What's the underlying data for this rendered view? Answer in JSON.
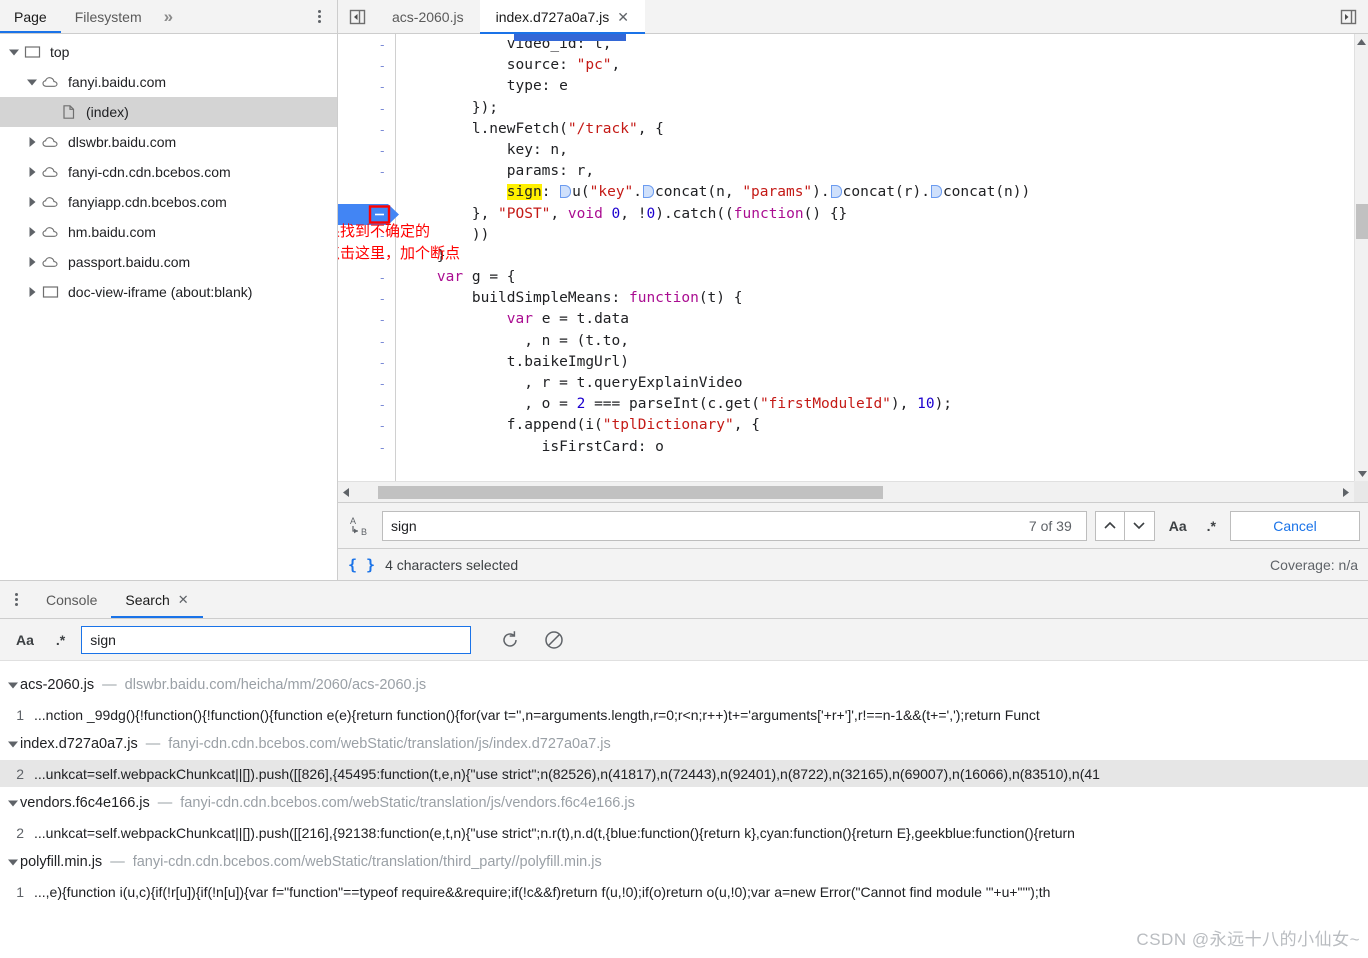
{
  "navigator": {
    "tabs": [
      {
        "label": "Page",
        "active": true
      },
      {
        "label": "Filesystem",
        "active": false
      }
    ],
    "more_label": "»",
    "tree": [
      {
        "indent": 0,
        "twisty": "down",
        "icon": "frame-icon",
        "label": "top",
        "selected": false
      },
      {
        "indent": 1,
        "twisty": "down",
        "icon": "cloud-icon",
        "label": "fanyi.baidu.com",
        "selected": false
      },
      {
        "indent": 2,
        "twisty": "none",
        "icon": "document-icon",
        "label": "(index)",
        "selected": true
      },
      {
        "indent": 1,
        "twisty": "right",
        "icon": "cloud-icon",
        "label": "dlswbr.baidu.com",
        "selected": false
      },
      {
        "indent": 1,
        "twisty": "right",
        "icon": "cloud-icon",
        "label": "fanyi-cdn.cdn.bcebos.com",
        "selected": false
      },
      {
        "indent": 1,
        "twisty": "right",
        "icon": "cloud-icon",
        "label": "fanyiapp.cdn.bcebos.com",
        "selected": false
      },
      {
        "indent": 1,
        "twisty": "right",
        "icon": "cloud-icon",
        "label": "hm.baidu.com",
        "selected": false
      },
      {
        "indent": 1,
        "twisty": "right",
        "icon": "cloud-icon",
        "label": "passport.baidu.com",
        "selected": false
      },
      {
        "indent": 1,
        "twisty": "right",
        "icon": "frame-icon",
        "label": "doc-view-iframe (about:blank)",
        "selected": false
      }
    ]
  },
  "editor": {
    "tabs": [
      {
        "label": "acs-2060.js",
        "active": false,
        "closable": false
      },
      {
        "label": "index.d727a0a7.js",
        "active": true,
        "closable": true
      }
    ],
    "close_glyph": "✕",
    "gutter_mark": "-",
    "annotation_line1": "如果找到不确定的",
    "annotation_line2": "可点击这里，加个断点",
    "code_lines": [
      {
        "text": "            video_id: t,"
      },
      {
        "text": "            source: \"pc\","
      },
      {
        "text": "            type: e"
      },
      {
        "text": "        });"
      },
      {
        "text": "        l.newFetch(\"/track\", {"
      },
      {
        "text": "            key: n,"
      },
      {
        "text": "            params: r,"
      },
      {
        "text": "            sign: u(\"key\".concat(n, \"params\").concat(r).concat(n))"
      },
      {
        "text": "        }, \"POST\", void 0, !0).catch((function() {}"
      },
      {
        "text": "        ))"
      },
      {
        "text": "    }"
      },
      {
        "text": "    var g = {"
      },
      {
        "text": "        buildSimpleMeans: function(t) {"
      },
      {
        "text": "            var e = t.data"
      },
      {
        "text": "              , n = (t.to,"
      },
      {
        "text": "            t.baikeImgUrl)"
      },
      {
        "text": "              , r = t.queryExplainVideo"
      },
      {
        "text": "              , o = 2 === parseInt(c.get(\"firstModuleId\"), 10);"
      },
      {
        "text": "            f.append(i(\"tplDictionary\", {"
      },
      {
        "text": "                isFirstCard: o"
      }
    ],
    "search": {
      "value": "sign",
      "placeholder": "Find",
      "match_count": "7 of 39",
      "prev_glyph": "⌃",
      "next_glyph": "⌄",
      "match_case_label": "Aa",
      "regex_label": ".*",
      "cancel_label": "Cancel"
    },
    "status": {
      "format_icon": "{ }",
      "text": "4 characters selected",
      "coverage": "Coverage: n/a"
    }
  },
  "drawer": {
    "tabs": [
      {
        "label": "Console",
        "active": false,
        "closable": false
      },
      {
        "label": "Search",
        "active": true,
        "closable": true
      }
    ],
    "close_glyph": "✕",
    "toolbar": {
      "match_case_label": "Aa",
      "regex_label": ".*",
      "query": "sign",
      "placeholder": "Search",
      "refresh_name": "refresh-icon",
      "clear_name": "clear-icon"
    },
    "results": [
      {
        "file": "acs-2060.js",
        "dash": "—",
        "url": "dlswbr.baidu.com/heicha/mm/2060/acs-2060.js",
        "matches": [
          {
            "line": "1",
            "code": "...nction _99dg(){!function(){!function(){function e(e){return function(){for(var t='',n=arguments.length,r=0;r<n;r++)t+='arguments['+r+']',r!==n-1&&(t+=',');return Funct",
            "highlighted": false
          }
        ]
      },
      {
        "file": "index.d727a0a7.js",
        "dash": "—",
        "url": "fanyi-cdn.cdn.bcebos.com/webStatic/translation/js/index.d727a0a7.js",
        "matches": [
          {
            "line": "2",
            "code": "...unkcat=self.webpackChunkcat||[]).push([[826],{45495:function(t,e,n){\"use strict\";n(82526),n(41817),n(72443),n(92401),n(8722),n(32165),n(69007),n(16066),n(83510),n(41",
            "highlighted": true
          }
        ]
      },
      {
        "file": "vendors.f6c4e166.js",
        "dash": "—",
        "url": "fanyi-cdn.cdn.bcebos.com/webStatic/translation/js/vendors.f6c4e166.js",
        "matches": [
          {
            "line": "2",
            "code": "...unkcat=self.webpackChunkcat||[]).push([[216],{92138:function(e,t,n){\"use strict\";n.r(t),n.d(t,{blue:function(){return k},cyan:function(){return E},geekblue:function(){return",
            "highlighted": false
          }
        ]
      },
      {
        "file": "polyfill.min.js",
        "dash": "—",
        "url": "fanyi-cdn.cdn.bcebos.com/webStatic/translation/third_party//polyfill.min.js",
        "matches": [
          {
            "line": "1",
            "code": "...,e){function i(u,c){if(!r[u]){if(!n[u]){var f=\"function\"==typeof require&&require;if(!c&&f)return f(u,!0);if(o)return o(u,!0);var a=new Error(\"Cannot find module '\"+u+\"'\");th",
            "highlighted": false
          }
        ]
      }
    ]
  },
  "watermark": "CSDN @永远十八的小仙女~",
  "colors": {
    "accent": "#1a73e8",
    "selection": "#3367d6",
    "highlight": "#fff000",
    "annotation": "#ff0000",
    "string": "#c41a16",
    "keyword": "#aa0d91",
    "number": "#1c00cf"
  }
}
